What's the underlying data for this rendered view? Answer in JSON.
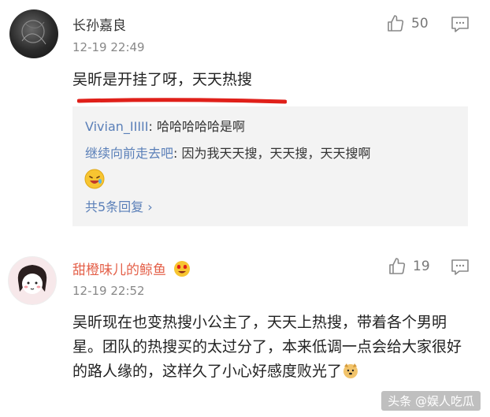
{
  "comments": [
    {
      "username": "长孙嘉良",
      "time": "12-19 22:49",
      "likes": "50",
      "text": "吴昕是开挂了呀，天天热搜",
      "replies": [
        {
          "name": "Vivian_IIIII",
          "text": ": 哈哈哈哈哈是啊"
        },
        {
          "name": "继续向前走去吧",
          "text": ": 因为我天天搜，天天搜，天天搜啊"
        }
      ],
      "more_replies": "共5条回复 ›"
    },
    {
      "username": "甜橙味儿的鲸鱼",
      "time": "12-19 22:52",
      "likes": "19",
      "text": "吴昕现在也变热搜小公主了，天天上热搜，带着各个男明星。团队的热搜买的太过分了，本来低调一点会给大家很好的路人缘的，这样久了小心好感度败光了"
    }
  ],
  "watermark": "头条 @娱人吃瓜",
  "icons": [
    "thumbs-up-icon",
    "reply-icon",
    "laughing-emoji-icon",
    "heart-eyes-emoji-icon",
    "dog-emoji-icon"
  ],
  "colors": {
    "highlight_red": "#e0201a",
    "reply_name": "#5a7fb8",
    "username_orange": "#e4614a"
  }
}
